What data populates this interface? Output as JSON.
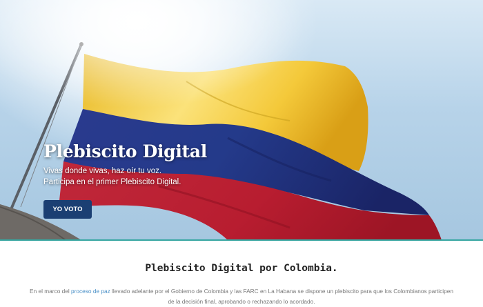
{
  "hero": {
    "title": "Plebiscito Digital",
    "subtitle_line1": "Vivas donde vivas, haz oír tu voz.",
    "subtitle_line2": "Participa en el primer Plebiscito Digital.",
    "cta_label": "YO VOTO",
    "flag_colors": {
      "yellow": "#f2c62a",
      "blue": "#1f2e7a",
      "red": "#c31f33"
    },
    "accent": "#35a6a0"
  },
  "intro": {
    "heading": "Plebiscito Digital por Colombia.",
    "text_before_link": "En el marco del ",
    "link_text": "proceso de paz",
    "text_after_link": " llevado adelante por el Gobierno de Colombia y las FARC en La Habana se dispone un plebiscito para que los Colombianos participen de la decisión final, aprobando o rechazando lo acordado."
  }
}
